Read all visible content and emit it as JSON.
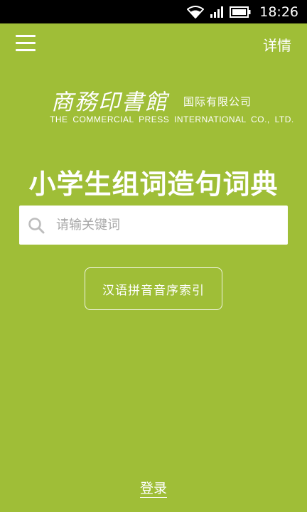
{
  "status_bar": {
    "time": "18:26",
    "icons": [
      "wifi-icon",
      "signal-icon",
      "battery-icon"
    ]
  },
  "app_bar": {
    "menu_icon": "menu-icon",
    "details_label": "详情"
  },
  "logo": {
    "name_cn": "商務印書館",
    "subtitle_cn": "国际有限公司",
    "name_en": "THE COMMERCIAL PRESS INTERNATIONAL CO., LTD."
  },
  "main": {
    "title": "小学生组词造句词典",
    "search": {
      "placeholder": "请输关键词",
      "value": ""
    },
    "index_button_label": "汉语拼音音序索引",
    "login_label": "登录"
  },
  "colors": {
    "background": "#9fbe37",
    "status_bar": "#000000",
    "text": "#ffffff",
    "search_bg": "#ffffff",
    "placeholder": "#a8a8a8"
  }
}
